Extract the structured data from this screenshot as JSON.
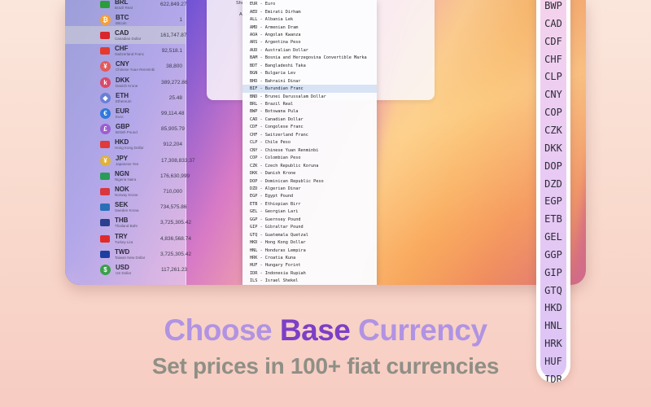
{
  "sidebar": {
    "items": [
      {
        "code": "BRL",
        "name": "Brazil Real",
        "value": "622,849.27",
        "icon": "brazil-flag",
        "color": "#2a9c3b"
      },
      {
        "code": "BTC",
        "name": "Bitcoin",
        "value": "1",
        "icon": "bitcoin-coin",
        "color": "#f2a037"
      },
      {
        "code": "CAD",
        "name": "Canadian Dollar",
        "value": "161,747.87",
        "icon": "canada-flag",
        "color": "#d9262b"
      },
      {
        "code": "CHF",
        "name": "Switzerland Franc",
        "value": "92,518.1",
        "icon": "swiss-flag",
        "color": "#e33a30"
      },
      {
        "code": "CNY",
        "name": "Chinese Yuan Renminbi",
        "value": "38,800",
        "icon": "yuan-coin",
        "color": "#e35a5a"
      },
      {
        "code": "DKK",
        "name": "Danish Krone",
        "value": "389,272.86",
        "icon": "krone-coin",
        "color": "#d94a6a"
      },
      {
        "code": "ETH",
        "name": "Ethereum",
        "value": "25.48",
        "icon": "ethereum-coin",
        "color": "#6b7fd6"
      },
      {
        "code": "EUR",
        "name": "Euro",
        "value": "99,114.48",
        "icon": "euro-coin",
        "color": "#2f79d9"
      },
      {
        "code": "GBP",
        "name": "British Pound",
        "value": "85,905.79",
        "icon": "pound-coin",
        "color": "#9b5fcf"
      },
      {
        "code": "HKD",
        "name": "Hong Kong Dollar",
        "value": "912,204",
        "icon": "hong-kong-flag",
        "color": "#e03a3a"
      },
      {
        "code": "JPY",
        "name": "Japanese Yen",
        "value": "17,308,833.37",
        "icon": "yen-coin",
        "color": "#e0b23a"
      },
      {
        "code": "NGN",
        "name": "Nigeria Naira",
        "value": "176,630,999",
        "icon": "nigeria-flag",
        "color": "#2a9c55"
      },
      {
        "code": "NOK",
        "name": "Norway Krone",
        "value": "710,000",
        "icon": "norway-flag",
        "color": "#d9363e"
      },
      {
        "code": "SEK",
        "name": "Sweden Krona",
        "value": "734,575.86",
        "icon": "sweden-flag",
        "color": "#2a6fb8"
      },
      {
        "code": "THB",
        "name": "Thailand Baht",
        "value": "3,725,305.42",
        "icon": "thailand-flag",
        "color": "#2b3f8f"
      },
      {
        "code": "TRY",
        "name": "Turkey Lira",
        "value": "4,836,568.74",
        "icon": "turkey-flag",
        "color": "#e02b2b"
      },
      {
        "code": "TWD",
        "name": "Taiwan New Dollar",
        "value": "3,725,305.42",
        "icon": "taiwan-flag",
        "color": "#1f3fa0"
      },
      {
        "code": "USD",
        "name": "US Dollar",
        "value": "117,261.23",
        "icon": "dollar-coin",
        "color": "#3aa04a"
      }
    ]
  },
  "form": {
    "shortcut_label": "Shortcut:",
    "assets_label": "Assets:"
  },
  "dropdown": {
    "items": [
      "EUR - Euro",
      "AED - Emirati Dirham",
      "ALL - Albania Lek",
      "AMD - Armenian Dram",
      "AOA - Angolan Kwanza",
      "ARS - Argentina Peso",
      "AUD - Australian Dollar",
      "BAM - Bosnia and Herzegovina Convertible Marka",
      "BDT - Bangladeshi Taka",
      "BGN - Bulgaria Lev",
      "BHD - Bahraini Dinar",
      "BIF - Burundian Franc",
      "BND - Brunei Darussalam Dollar",
      "BRL - Brazil Real",
      "BWP - Botswana Pula",
      "CAD - Canadian Dollar",
      "CDF - Congolese Franc",
      "CHF - Switzerland Franc",
      "CLP - Chile Peso",
      "CNY - Chinese Yuan Renminbi",
      "COP - Colombian Peso",
      "CZK - Czech Republic Koruna",
      "DKK - Danish Krone",
      "DOP - Dominican Republic Peso",
      "DZD - Algerian Dinar",
      "EGP - Egypt Pound",
      "ETB - Ethiopian Birr",
      "GEL - Georgian Lari",
      "GGP - Guernsey Pound",
      "GIP - Gibraltar Pound",
      "GTQ - Guatemala Quetzal",
      "HKD - Hong Kong Dollar",
      "HNL - Honduras Lempira",
      "HRK - Croatia Kuna",
      "HUF - Hungary Forint",
      "IDR - Indonesia Rupiah",
      "ILS - Israel Shekel"
    ],
    "highlighted_index": 11
  },
  "picker": {
    "items": [
      "BWP",
      "CAD",
      "CDF",
      "CHF",
      "CLP",
      "CNY",
      "COP",
      "CZK",
      "DKK",
      "DOP",
      "DZD",
      "EGP",
      "ETB",
      "GEL",
      "GGP",
      "GIP",
      "GTQ",
      "HKD",
      "HNL",
      "HRK",
      "HUF",
      "IDR"
    ]
  },
  "headline": {
    "part1": "Choose ",
    "part2": "Base",
    "part3": " Currency"
  },
  "subline": "Set prices in 100+ fiat currencies",
  "colors": {
    "headline_light": "#b193e3",
    "headline_dark": "#7c3fc6",
    "subline": "#8f8f86"
  }
}
